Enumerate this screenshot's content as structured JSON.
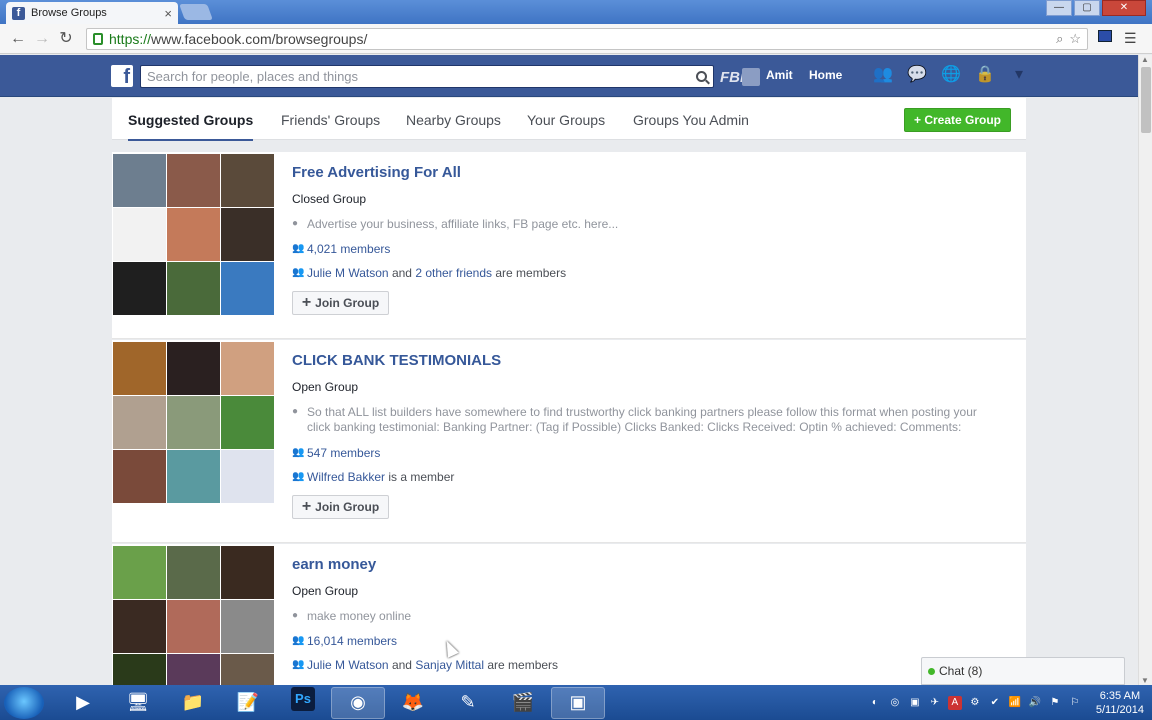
{
  "browser": {
    "tab_title": "Browse Groups",
    "tab_favicon": "f",
    "tab_close": "×",
    "url_prefix": "https://",
    "url_host": "www.facebook.com",
    "url_path": "/browsegroups/",
    "win_min": "—",
    "win_max": "▢",
    "win_close": "✕"
  },
  "fb": {
    "logo": "f",
    "search_placeholder": "Search for people, places and things",
    "fbp_badge": "FBP",
    "user_name": "Amit",
    "home_label": "Home"
  },
  "tabs": [
    "Suggested Groups",
    "Friends' Groups",
    "Nearby Groups",
    "Your Groups",
    "Groups You Admin"
  ],
  "create_button": "+ Create Group",
  "groups": [
    {
      "name": "Free Advertising For All",
      "privacy": "Closed Group",
      "description": "Advertise your business, affiliate links, FB page etc. here...",
      "members": "4,021 members",
      "friends_link1": "Julie M Watson",
      "friends_mid": "and",
      "friends_link2": "2 other friends",
      "friends_tail": "are members",
      "join_label": "Join Group",
      "thumb_colors": [
        "#6d7e8f",
        "#8a5a4a",
        "#5a4a3a",
        "#f2f2f2",
        "#c47a5a",
        "#3a2f28",
        "#1f1f1f",
        "#4a6a3a",
        "#3a7ac0"
      ]
    },
    {
      "name": "CLICK BANK TESTIMONIALS",
      "privacy": "Open Group",
      "description": "So that ALL list builders have somewhere to find trustworthy click banking partners please follow this format when posting your click banking testimonial: Banking Partner: (Tag if Possible) Clicks Banked: Clicks Received: Optin % achieved: Comments:",
      "members": "547 members",
      "friends_link1": "Wilfred Bakker",
      "friends_mid": "is a member",
      "friends_link2": "",
      "friends_tail": "",
      "join_label": "Join Group",
      "thumb_colors": [
        "#a0662a",
        "#2a2020",
        "#d0a080",
        "#b0a090",
        "#8a9a7a",
        "#4a8a3a",
        "#7a4a3a",
        "#5a9aa0",
        "#dfe3ee"
      ]
    },
    {
      "name": "earn money",
      "privacy": "Open Group",
      "description": "make money online",
      "members": "16,014 members",
      "friends_link1": "Julie M Watson",
      "friends_mid": "and",
      "friends_link2": "Sanjay Mittal",
      "friends_tail": "are members",
      "join_label": "Join Group",
      "thumb_colors": [
        "#6aa04a",
        "#5a6a4a",
        "#3a2a20",
        "#3a2a22",
        "#b06a5a",
        "#8a8a8a",
        "#2a3a1a",
        "#5a3a5a",
        "#6a5a4a"
      ]
    }
  ],
  "chat_label": "Chat (8)",
  "taskbar": {
    "ps_label": "Ps",
    "time": "6:35 AM",
    "date": "5/11/2014"
  }
}
